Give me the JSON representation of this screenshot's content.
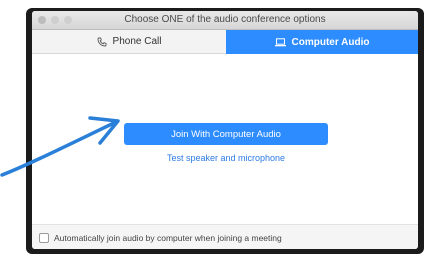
{
  "window": {
    "title": "Choose ONE of the audio conference options"
  },
  "tabs": [
    {
      "label": "Phone Call",
      "icon": "phone-icon",
      "active": false
    },
    {
      "label": "Computer Audio",
      "icon": "monitor-icon",
      "active": true
    }
  ],
  "main": {
    "join_button_label": "Join With Computer Audio",
    "test_link_label": "Test speaker and microphone"
  },
  "footer": {
    "auto_join_label": "Automatically join audio by computer when joining a meeting",
    "auto_join_checked": false
  },
  "colors": {
    "accent": "#2d8cff",
    "annotation_arrow": "#2a7fd8"
  }
}
